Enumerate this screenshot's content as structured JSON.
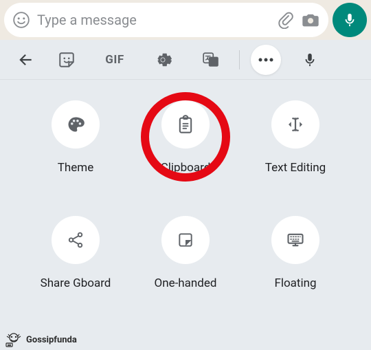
{
  "chat": {
    "placeholder": "Type a message"
  },
  "toolbar": {
    "gif_label": "GIF"
  },
  "options": [
    {
      "label": "Theme"
    },
    {
      "label": "Clipboard"
    },
    {
      "label": "Text Editing"
    },
    {
      "label": "Share Gboard"
    },
    {
      "label": "One-handed"
    },
    {
      "label": "Floating"
    }
  ],
  "highlight": {
    "color": "#e50914",
    "target_index": 1
  },
  "watermark": {
    "text": "Gossipfunda"
  }
}
